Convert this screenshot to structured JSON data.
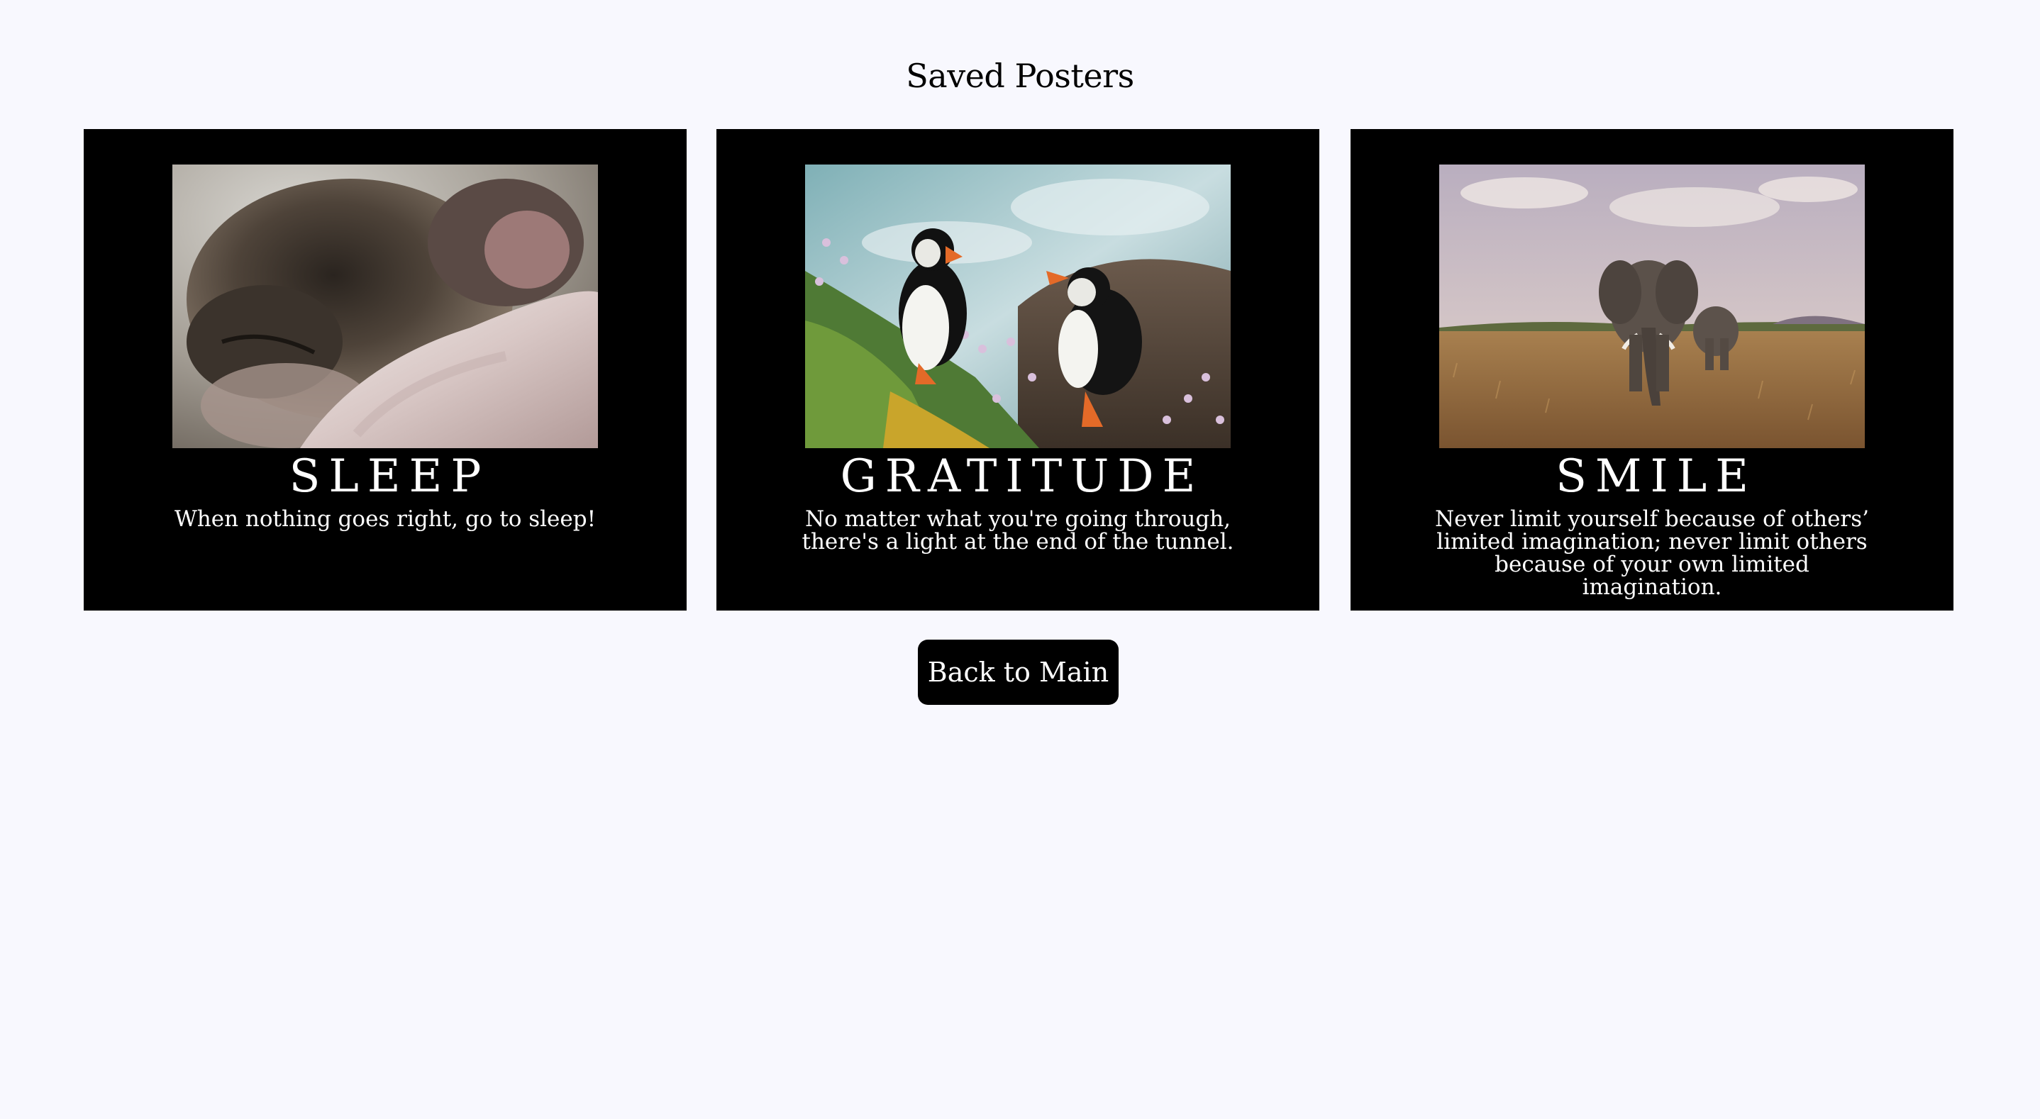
{
  "page": {
    "title": "Saved Posters"
  },
  "posters": [
    {
      "title": "SLEEP",
      "quote": "When nothing goes right, go to sleep!",
      "image": "sleeping-dog-photo"
    },
    {
      "title": "GRATITUDE",
      "quote": "No matter what you're going through, there's a light at the end of the tunnel.",
      "image": "puffins-photo"
    },
    {
      "title": "SMILE",
      "quote": "Never limit yourself because of others’ limited imagination; never limit others because of your own limited imagination.",
      "image": "elephants-photo"
    }
  ],
  "actions": {
    "back_label": "Back to Main"
  },
  "colors": {
    "background": "#f8f8fe",
    "poster_background": "#000000",
    "poster_text": "#ffffff",
    "button_background": "#000000",
    "button_text": "#ffffff"
  }
}
